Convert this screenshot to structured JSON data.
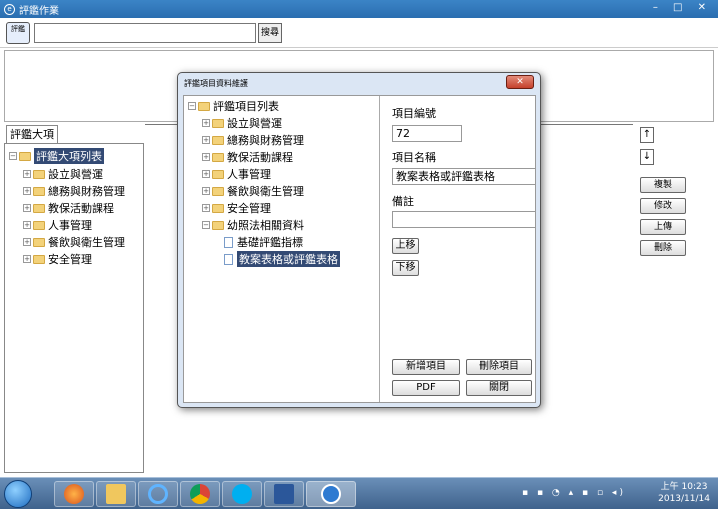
{
  "window": {
    "title": "評鑑作業",
    "controls": "– □ ✕"
  },
  "toolbar": {
    "app_icon_label": "評鑑",
    "search_value": "",
    "search_button": "搜尋"
  },
  "left": {
    "tab": "評鑑大項",
    "root": "評鑑大項列表",
    "items": [
      "設立與營運",
      "總務與財務管理",
      "教保活動課程",
      "人事管理",
      "餐飲與衛生管理",
      "安全管理"
    ]
  },
  "side_buttons": {
    "up": "↑",
    "down": "↓",
    "copy": "複製",
    "edit": "修改",
    "upload": "上傳",
    "delete": "刪除"
  },
  "dialog": {
    "title": "評鑑項目資料維護",
    "close": "✕",
    "tree": {
      "root": "評鑑項目列表",
      "items": [
        "設立與營運",
        "總務與財務管理",
        "教保活動課程",
        "人事管理",
        "餐飲與衛生管理",
        "安全管理",
        "幼照法相關資料"
      ],
      "children": [
        "基礎評鑑指標",
        "教案表格或評鑑表格"
      ]
    },
    "form": {
      "id_label": "項目編號",
      "id_value": "72",
      "name_label": "項目名稱",
      "name_value": "教案表格或評鑑表格",
      "note_label": "備註",
      "note_value": ""
    },
    "buttons": {
      "move_up": "上移",
      "move_down": "下移",
      "add": "新增項目",
      "remove": "刪除項目",
      "pdf": "PDF",
      "close": "關閉"
    }
  },
  "taskbar": {
    "time": "上午 10:23",
    "date": "2013/11/14"
  }
}
